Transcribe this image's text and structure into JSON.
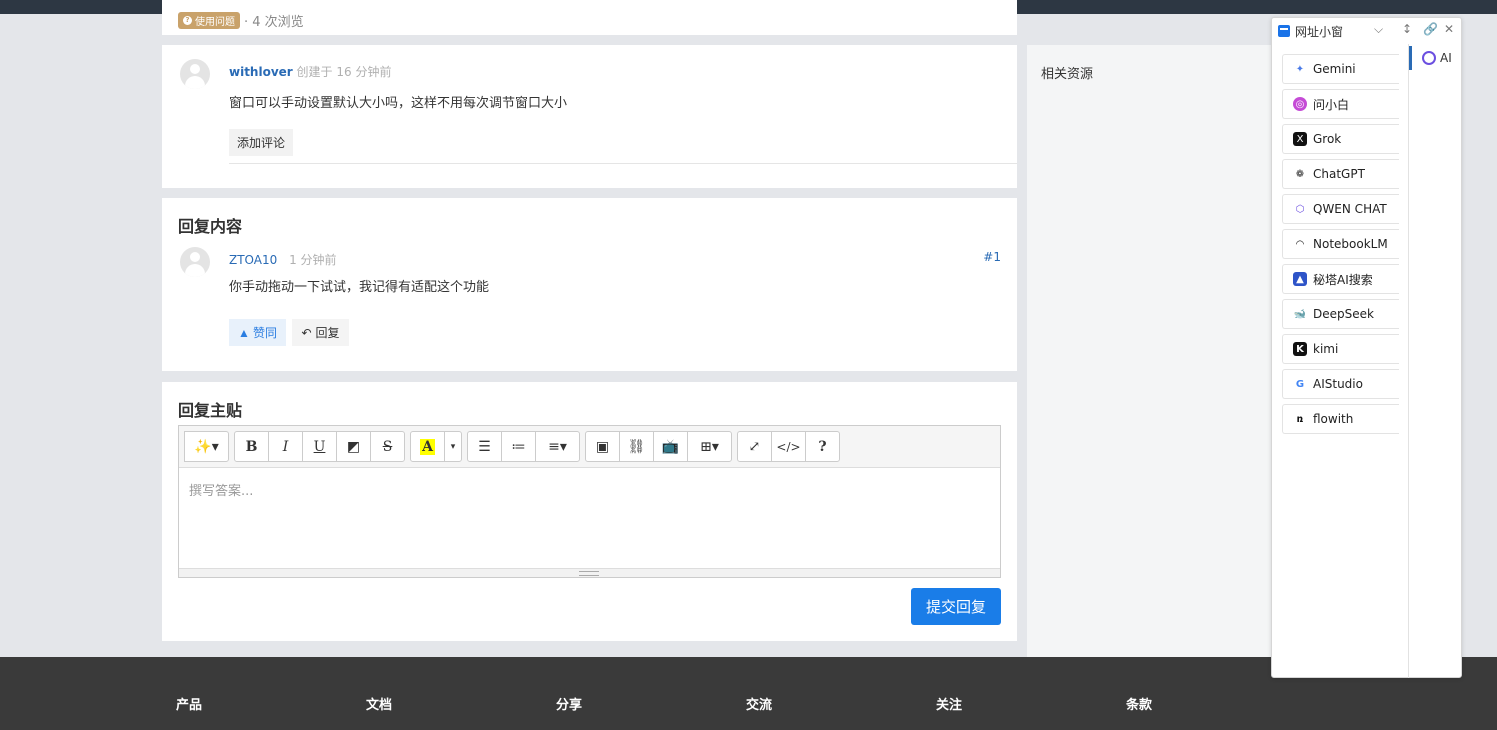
{
  "question_meta": {
    "tag": "使用问题",
    "views": "· 4 次浏览"
  },
  "post": {
    "author": "withlover",
    "created": "创建于 16 分钟前",
    "content": "窗口可以手动设置默认大小吗，这样不用每次调节窗口大小",
    "add_comment": "添加评论"
  },
  "replies": {
    "title": "回复内容",
    "items": [
      {
        "author": "ZTOA10",
        "time": "1 分钟前",
        "floor": "#1",
        "content": "你手动拖动一下试试，我记得有适配这个功能",
        "vote_label": "赞同",
        "reply_label": "回复"
      }
    ]
  },
  "reply_form": {
    "title": "回复主贴",
    "placeholder": "撰写答案...",
    "submit_label": "提交回复",
    "toolbar": [
      "magic-icon",
      "bold",
      "italic",
      "underline",
      "eraser",
      "strikethrough",
      "highlight",
      "dropdown",
      "bullet-list",
      "numbered-list",
      "align",
      "image",
      "link",
      "bilibili",
      "table",
      "fullscreen",
      "code-view",
      "help"
    ]
  },
  "sidebar": {
    "title": "相关资源"
  },
  "footer": {
    "links": [
      "产品",
      "文档",
      "分享",
      "交流",
      "关注",
      "条款"
    ]
  },
  "sidewin": {
    "title": "网址小窗",
    "items": [
      {
        "label": "Gemini",
        "icon": "gemini-icon",
        "color": "#4a7be8"
      },
      {
        "label": "问小白",
        "icon": "wenxiaobai-icon",
        "color": "#c54bd6"
      },
      {
        "label": "Grok",
        "icon": "grok-icon",
        "color": "#111111"
      },
      {
        "label": "ChatGPT",
        "icon": "chatgpt-icon",
        "color": "#333333"
      },
      {
        "label": "QWEN CHAT",
        "icon": "qwen-icon",
        "color": "#6b4fe0"
      },
      {
        "label": "NotebookLM",
        "icon": "notebooklm-icon",
        "color": "#111111"
      },
      {
        "label": "秘塔AI搜索",
        "icon": "metaso-icon",
        "color": "#2e54c8"
      },
      {
        "label": "DeepSeek",
        "icon": "deepseek-icon",
        "color": "#4d6bfe"
      },
      {
        "label": "kimi",
        "icon": "kimi-icon",
        "color": "#111111"
      },
      {
        "label": "AIStudio",
        "icon": "google-icon",
        "color": "#4285f4"
      },
      {
        "label": "flowith",
        "icon": "flowith-icon",
        "color": "#111111"
      }
    ],
    "tab_label": "AI"
  },
  "colors": {
    "accent": "#1a7de8",
    "link": "#2a6bb5",
    "footer_bg": "#3a3a3a",
    "topbar_bg": "#2d3743"
  }
}
